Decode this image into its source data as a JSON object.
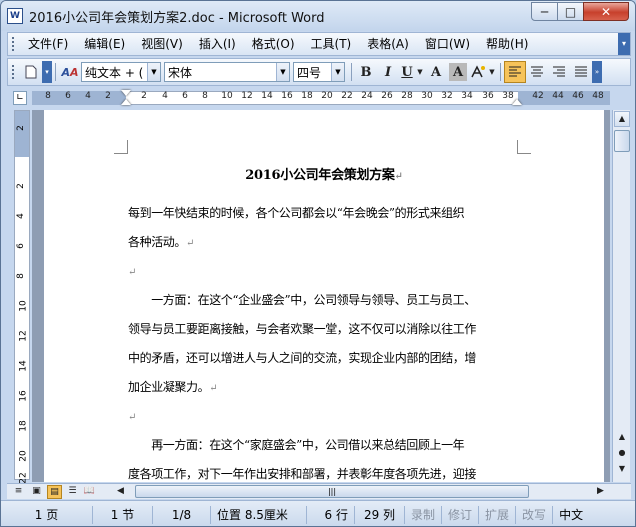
{
  "window": {
    "title": "2016小公司年会策划方案2.doc - Microsoft Word",
    "app_icon": "W",
    "controls": {
      "minimize": "─",
      "maximize": "□",
      "close": "✕"
    }
  },
  "menubar": {
    "items": [
      "文件(F)",
      "编辑(E)",
      "视图(V)",
      "插入(I)",
      "格式(O)",
      "工具(T)",
      "表格(A)",
      "窗口(W)",
      "帮助(H)"
    ]
  },
  "toolbar": {
    "style_value": "纯文本 + (",
    "font_value": "宋体",
    "size_value": "四号",
    "bold": "B",
    "italic": "I",
    "underline": "U",
    "char_border": "A",
    "char_shading": "A",
    "highlight_icon": "highlight-icon"
  },
  "ruler": {
    "numbers": [
      "8",
      "6",
      "4",
      "2",
      "2",
      "4",
      "6",
      "8",
      "10",
      "12",
      "14",
      "16",
      "18",
      "20",
      "22",
      "24",
      "26",
      "28",
      "30",
      "32",
      "34",
      "36",
      "38",
      "42",
      "44",
      "46",
      "48"
    ]
  },
  "vruler": {
    "numbers": [
      "2",
      "2",
      "4",
      "6",
      "8",
      "10",
      "12",
      "14",
      "16",
      "18",
      "20",
      "22"
    ]
  },
  "document": {
    "title": "2016小公司年会策划方案",
    "lines": [
      "每到一年快结束的时候，各个公司都会以“年会晚会”的形式来组织",
      "各种活动。",
      "",
      "　　一方面：在这个“企业盛会”中，公司领导与领导、员工与员工、",
      "领导与员工要距离接触，与会者欢聚一堂，这不仅可以消除以往工作",
      "中的矛盾，还可以增进人与人之间的交流，实现企业内部的团结，增",
      "加企业凝聚力。",
      "",
      "　　再一方面：在这个“家庭盛会”中，公司借以来总结回顾上一年",
      "度各项工作，对下一年作出安排和部署，并表彰年度各项先进，迎接"
    ],
    "paragraph_mark": "↵"
  },
  "statusbar": {
    "page": "1 页",
    "section": "1 节",
    "page_of": "1/8",
    "position": "位置 8.5厘米",
    "line": "6 行",
    "column": "29 列",
    "rec": "录制",
    "trk": "修订",
    "ext": "扩展",
    "ovr": "改写",
    "lang": "中文"
  }
}
